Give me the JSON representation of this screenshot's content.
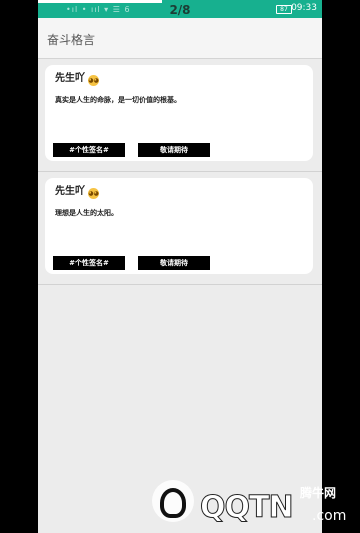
{
  "status_bar": {
    "signal_text": "•ıl • ııl ▾ ☰ 6",
    "page_counter": "2/8",
    "battery": "87",
    "time": "09:33"
  },
  "app_bar": {
    "title": "奋斗格言"
  },
  "cards": [
    {
      "author": "先生吖",
      "quote": "真实是人生的命脉，是一切价值的根基。",
      "tag_label": "#个性签名#",
      "action_label": "敬请期待"
    },
    {
      "author": "先生吖",
      "quote": "理想是人生的太阳。",
      "tag_label": "#个性签名#",
      "action_label": "敬请期待"
    }
  ],
  "watermark": {
    "brand": "QQTN",
    "sub": "腾牛网",
    "com": ".com",
    "icon": "qqtn-logo"
  },
  "colors": {
    "status_bar": "#17b08f",
    "page_bg": "#ececec",
    "card_bg": "#ffffff",
    "button_bg": "#000000"
  }
}
